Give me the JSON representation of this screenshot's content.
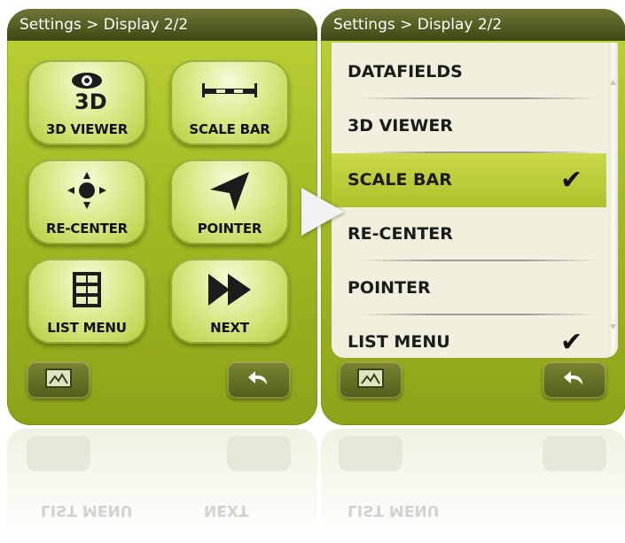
{
  "left_panel": {
    "title": "Settings > Display 2/2",
    "tiles": [
      {
        "label": "3D VIEWER",
        "icon": "3d-eye-icon"
      },
      {
        "label": "SCALE BAR",
        "icon": "scale-bar-icon"
      },
      {
        "label": "RE-CENTER",
        "icon": "recenter-icon"
      },
      {
        "label": "POINTER",
        "icon": "pointer-arrow-icon"
      },
      {
        "label": "LIST MENU",
        "icon": "grid-list-icon"
      },
      {
        "label": "NEXT",
        "icon": "fast-forward-icon"
      }
    ],
    "bottom_buttons": [
      {
        "icon": "map-view-icon"
      },
      {
        "icon": "back-arrow-icon"
      }
    ]
  },
  "right_panel": {
    "title": "Settings > Display 2/2",
    "items": [
      {
        "label": "DATAFIELDS",
        "checked": false,
        "selected": false
      },
      {
        "label": "3D VIEWER",
        "checked": false,
        "selected": false
      },
      {
        "label": "SCALE BAR",
        "checked": true,
        "selected": true
      },
      {
        "label": "RE-CENTER",
        "checked": false,
        "selected": false
      },
      {
        "label": "POINTER",
        "checked": false,
        "selected": false
      },
      {
        "label": "LIST MENU",
        "checked": true,
        "selected": false
      }
    ],
    "check_glyph": "✔",
    "bottom_buttons": [
      {
        "icon": "map-view-icon"
      },
      {
        "icon": "back-arrow-icon"
      }
    ]
  },
  "transition_arrow": {
    "icon": "right-arrow-icon"
  },
  "reflection": {
    "left_text": "LIST MENU",
    "left_text_2": "NEXT",
    "right_text": "LIST MENU"
  },
  "colors": {
    "panel_green": "#a4bb24",
    "titlebar": "#525a20",
    "list_bg": "#f1f0de",
    "selected_row": "#bccd3a"
  }
}
